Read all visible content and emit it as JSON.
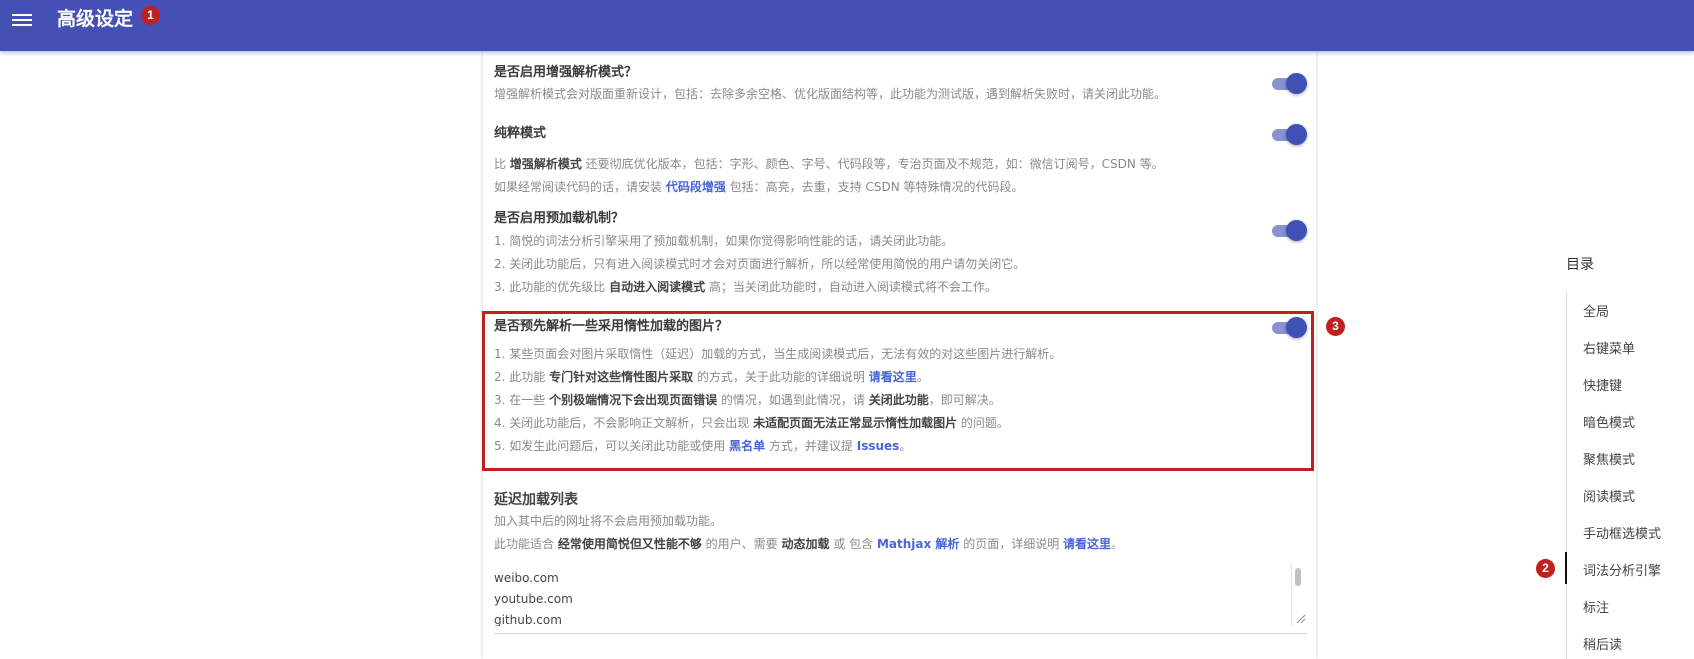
{
  "header": {
    "title": "高级设定",
    "badge": "1"
  },
  "settings": [
    {
      "title": "是否启用增强解析模式？",
      "enabled": true,
      "lines": [
        [
          {
            "t": "增强解析模式会对版面重新设计，包括：去除多余空格、优化版面结构等，此功能为测试版，遇到解析失败时，请关闭此功能。"
          }
        ]
      ]
    },
    {
      "title": "纯粹模式",
      "enabled": true,
      "lines": [
        [
          {
            "t": "比 "
          },
          {
            "t": "增强解析模式",
            "s": "b"
          },
          {
            "t": " 还要彻底优化版本，包括：字形、颜色、字号、代码段等，专治页面及不规范，如：微信订阅号，CSDN 等。"
          }
        ],
        [
          {
            "t": "如果经常阅读代码的话，请安装 "
          },
          {
            "t": "代码段增强",
            "s": "a"
          },
          {
            "t": " 包括：高亮，去重，支持 CSDN 等特殊情况的代码段。"
          }
        ]
      ]
    },
    {
      "title": "是否启用预加载机制？",
      "enabled": true,
      "lines": [
        [
          {
            "t": "1. 简悦的词法分析引擎采用了预加载机制，如果你觉得影响性能的话，请关闭此功能。"
          }
        ],
        [
          {
            "t": "2. 关闭此功能后，只有进入阅读模式时才会对页面进行解析，所以经常使用简悦的用户请勿关闭它。"
          }
        ],
        [
          {
            "t": "3. 此功能的优先级比 "
          },
          {
            "t": "自动进入阅读模式",
            "s": "b"
          },
          {
            "t": " 高；当关闭此功能时，自动进入阅读模式将不会工作。"
          }
        ]
      ]
    },
    {
      "title": "是否预先解析一些采用惰性加载的图片？",
      "enabled": true,
      "badge": "3",
      "lines": [
        [
          {
            "t": "1. 某些页面会对图片采取惰性（延迟）加载的方式，当生成阅读模式后，无法有效的对这些图片进行解析。"
          }
        ],
        [
          {
            "t": "2. 此功能 "
          },
          {
            "t": "专门针对这些惰性图片采取",
            "s": "b"
          },
          {
            "t": " 的方式，关于此功能的详细说明 "
          },
          {
            "t": "请看这里",
            "s": "a"
          },
          {
            "t": "。"
          }
        ],
        [
          {
            "t": "3. 在一些 "
          },
          {
            "t": "个别极端情况下会出现页面错误",
            "s": "b"
          },
          {
            "t": " 的情况，如遇到此情况，请 "
          },
          {
            "t": "关闭此功能",
            "s": "b"
          },
          {
            "t": "，即可解决。"
          }
        ],
        [
          {
            "t": "4. 关闭此功能后，不会影响正文解析，只会出现 "
          },
          {
            "t": "未适配页面无法正常显示惰性加载图片",
            "s": "b"
          },
          {
            "t": " 的问题。"
          }
        ],
        [
          {
            "t": "5. 如发生此问题后，可以关闭此功能或使用 "
          },
          {
            "t": "黑名单",
            "s": "a"
          },
          {
            "t": " 方式，并建议提 "
          },
          {
            "t": "Issues",
            "s": "a"
          },
          {
            "t": "。"
          }
        ]
      ]
    }
  ],
  "delay_list": {
    "title": "延迟加载列表",
    "lines": [
      [
        {
          "t": "加入其中后的网址将不会启用预加载功能。"
        }
      ],
      [
        {
          "t": "此功能适合 "
        },
        {
          "t": "经常使用简悦但又性能不够",
          "s": "b"
        },
        {
          "t": " 的用户、需要 "
        },
        {
          "t": "动态加载",
          "s": "b"
        },
        {
          "t": " 或 包含 "
        },
        {
          "t": "Mathjax 解析",
          "s": "a"
        },
        {
          "t": " 的页面，详细说明 "
        },
        {
          "t": "请看这里",
          "s": "a"
        },
        {
          "t": "。"
        }
      ]
    ],
    "textarea_lines": [
      "weibo.com",
      "youtube.com",
      "github.com"
    ]
  },
  "toc": {
    "title": "目录",
    "active_badge": "2",
    "active_index": 7,
    "items": [
      "全局",
      "右键菜单",
      "快捷键",
      "暗色模式",
      "聚焦模式",
      "阅读模式",
      "手动框选模式",
      "词法分析引擎",
      "标注",
      "稍后读"
    ]
  },
  "colors": {
    "header_bg": "#4550b5",
    "badge": "#c0211f",
    "link": "#4a66d6",
    "toggle_knob": "#3f51b5",
    "toggle_track": "#8a92d6"
  }
}
